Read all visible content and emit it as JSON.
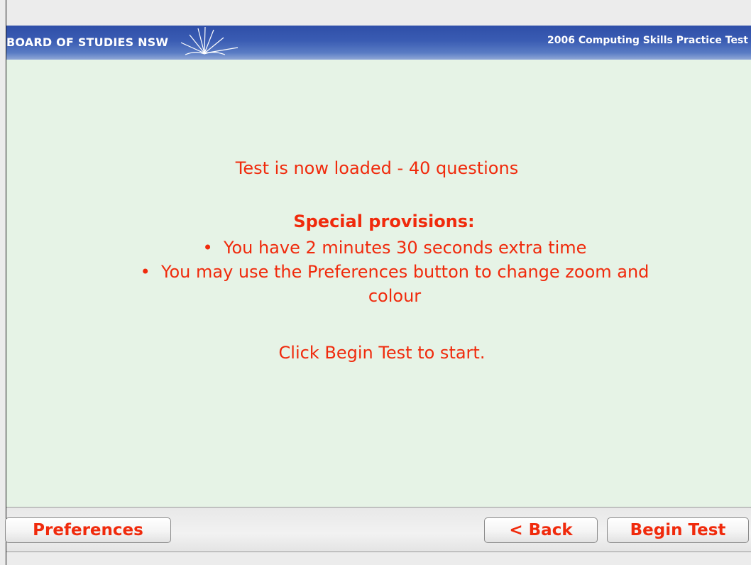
{
  "header": {
    "brand": "BOARD OF STUDIES NSW",
    "test_name": "2006 Computing Skills Practice Test"
  },
  "main": {
    "loaded_message": "Test is now loaded - 40 questions",
    "provisions_heading": "Special provisions:",
    "provisions": [
      "You have 2 minutes 30 seconds extra time",
      "You may use the Preferences button to change zoom and colour"
    ],
    "start_message": "Click Begin Test to start."
  },
  "footer": {
    "preferences_label": "Preferences",
    "back_label": "< Back",
    "begin_label": "Begin Test"
  },
  "colors": {
    "header_blue": "#2f4fa8",
    "content_background": "#e6f3e6",
    "accent_red": "#f02a0c"
  }
}
